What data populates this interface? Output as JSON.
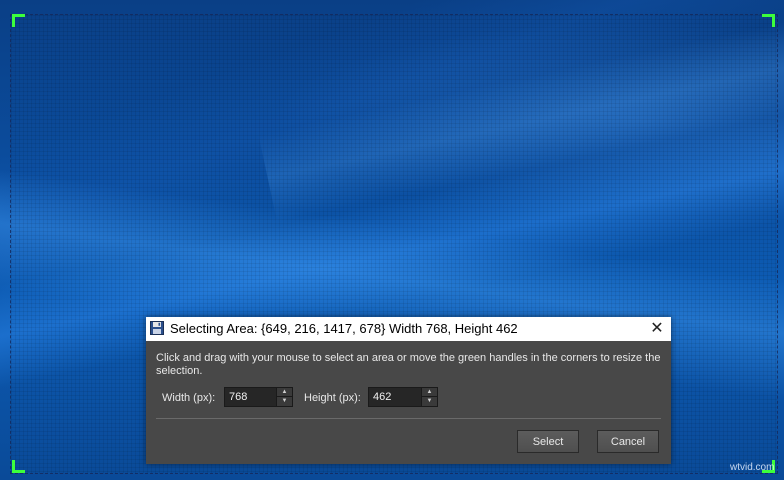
{
  "dialog": {
    "title": "Selecting Area: {649, 216, 1417, 678} Width 768, Height 462",
    "close_glyph": "✕",
    "instructions": "Click and drag with your mouse to select an area or move the green handles in the corners to resize the selection.",
    "width_label": "Width (px):",
    "width_value": "768",
    "height_label": "Height (px):",
    "height_value": "462",
    "select_label": "Select",
    "cancel_label": "Cancel"
  },
  "icons": {
    "title": "floppy-disk-icon",
    "close": "close-icon",
    "spin_up": "arrow-up-icon",
    "spin_down": "arrow-down-icon"
  },
  "colors": {
    "handle": "#3cff3c",
    "dialog_bg": "#484848",
    "desktop_blue": "#0b4d9e"
  },
  "watermark": "wtvid.com"
}
